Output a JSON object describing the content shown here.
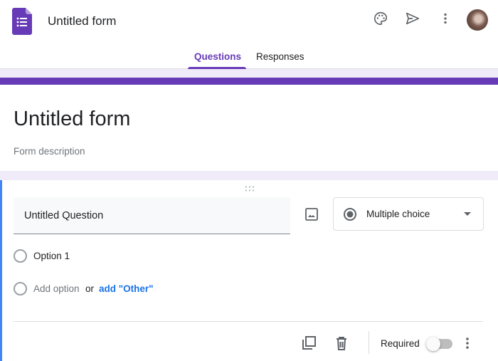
{
  "header": {
    "app_title": "Untitled form",
    "icons": [
      "forms-logo-icon",
      "palette-icon",
      "send-icon",
      "more-vert-icon",
      "avatar"
    ],
    "accent_color": "#673ab7"
  },
  "tabs": [
    {
      "label": "Questions",
      "active": true
    },
    {
      "label": "Responses",
      "active": false
    }
  ],
  "form": {
    "title": "Untitled form",
    "description_placeholder": "Form description"
  },
  "question": {
    "title": "Untitled Question",
    "type": "Multiple choice",
    "options": [
      "Option 1"
    ],
    "add_option_label": "Add option",
    "or_label": "or",
    "add_other_label": "add \"Other\"",
    "required_label": "Required",
    "required": false
  }
}
